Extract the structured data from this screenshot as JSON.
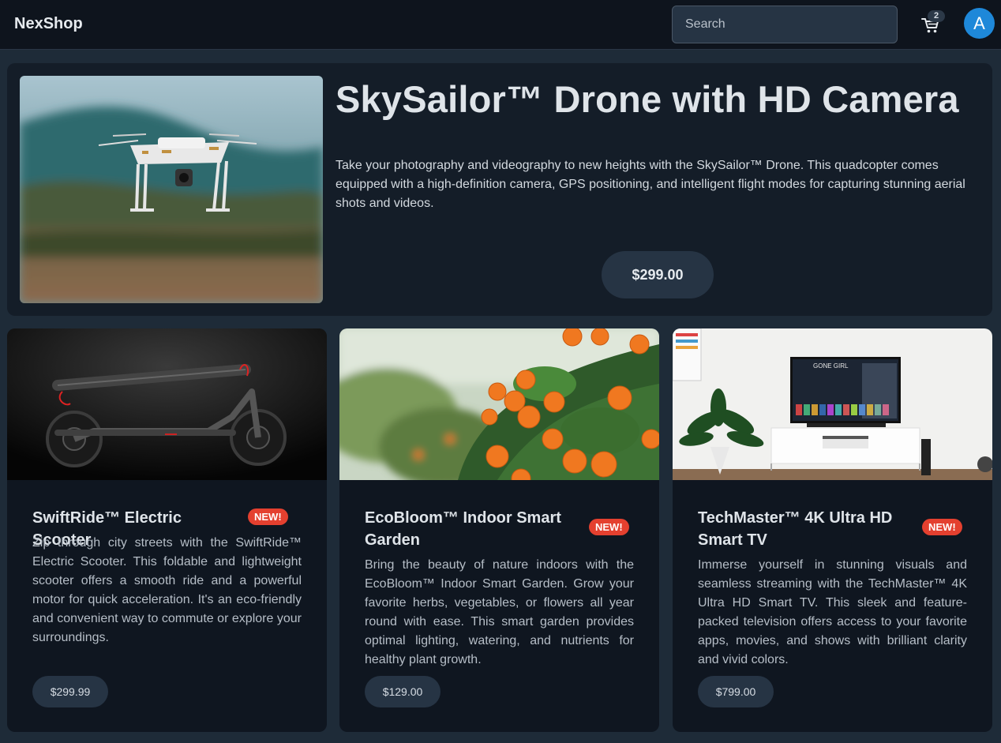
{
  "header": {
    "brand": "NexShop",
    "search_placeholder": "Search",
    "cart_count": "2",
    "avatar_initial": "A"
  },
  "hero": {
    "title": "SkySailor™ Drone with HD Camera",
    "description": "Take your photography and videography to new heights with the SkySailor™ Drone. This quadcopter comes equipped with a high-definition camera, GPS positioning, and intelligent flight modes for capturing stunning aerial shots and videos.",
    "price": "$299.00"
  },
  "products": [
    {
      "title": "SwiftRide™ Electric Scooter",
      "badge": "NEW!",
      "description": "Zip through city streets with the SwiftRide™ Electric Scooter. This foldable and lightweight scooter offers a smooth ride and a powerful motor for quick acceleration. It's an eco-friendly and convenient way to commute or explore your surroundings.",
      "price": "$299.99"
    },
    {
      "title": "EcoBloom™ Indoor Smart Garden",
      "badge": "NEW!",
      "description": "Bring the beauty of nature indoors with the EcoBloom™ Indoor Smart Garden. Grow your favorite herbs, vegetables, or flowers all year round with ease. This smart garden provides optimal lighting, watering, and nutrients for healthy plant growth.",
      "price": "$129.00"
    },
    {
      "title": "TechMaster™ 4K Ultra HD Smart TV",
      "badge": "NEW!",
      "description": "Immerse yourself in stunning visuals and seamless streaming with the TechMaster™ 4K Ultra HD Smart TV. This sleek and feature-packed television offers access to your favorite apps, movies, and shows with brilliant clarity and vivid colors.",
      "price": "$799.00",
      "tv_screen_text": "GONE GIRL"
    }
  ]
}
